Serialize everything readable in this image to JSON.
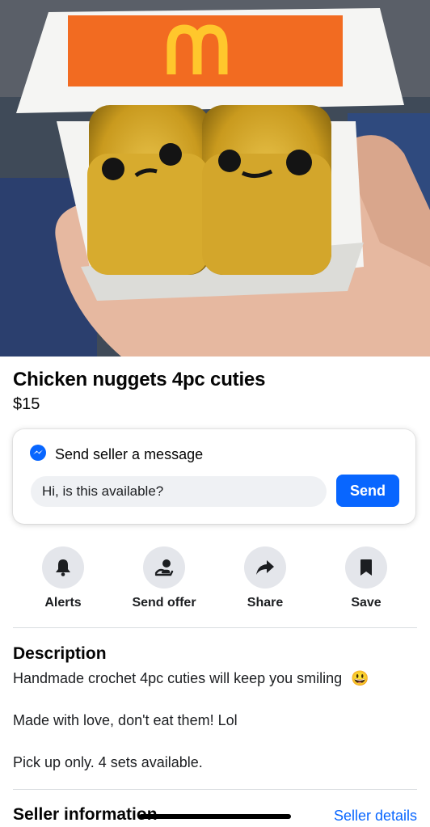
{
  "listing": {
    "title": "Chicken nuggets 4pc cuties",
    "price": "$15",
    "photo_icon": "crochet-nuggets-photo"
  },
  "message": {
    "heading": "Send seller a message",
    "input_value": "Hi, is this available?",
    "send_label": "Send",
    "icon": "messenger-icon"
  },
  "actions": [
    {
      "label": "Alerts",
      "icon": "bell-icon"
    },
    {
      "label": "Send offer",
      "icon": "offer-icon"
    },
    {
      "label": "Share",
      "icon": "share-arrow-icon"
    },
    {
      "label": "Save",
      "icon": "bookmark-icon"
    }
  ],
  "description": {
    "heading": "Description",
    "lines": [
      "Handmade crochet 4pc cuties will keep you smiling",
      "Made with love, don't eat them! Lol",
      "Pick up only.  4 sets available."
    ],
    "emoji": "😃"
  },
  "seller": {
    "heading": "Seller information",
    "link": "Seller details"
  },
  "colors": {
    "accent": "#0866ff",
    "action_circle": "#e4e6eb",
    "logo_box": "#f26b21",
    "logo_arches": "#ffc72c"
  }
}
